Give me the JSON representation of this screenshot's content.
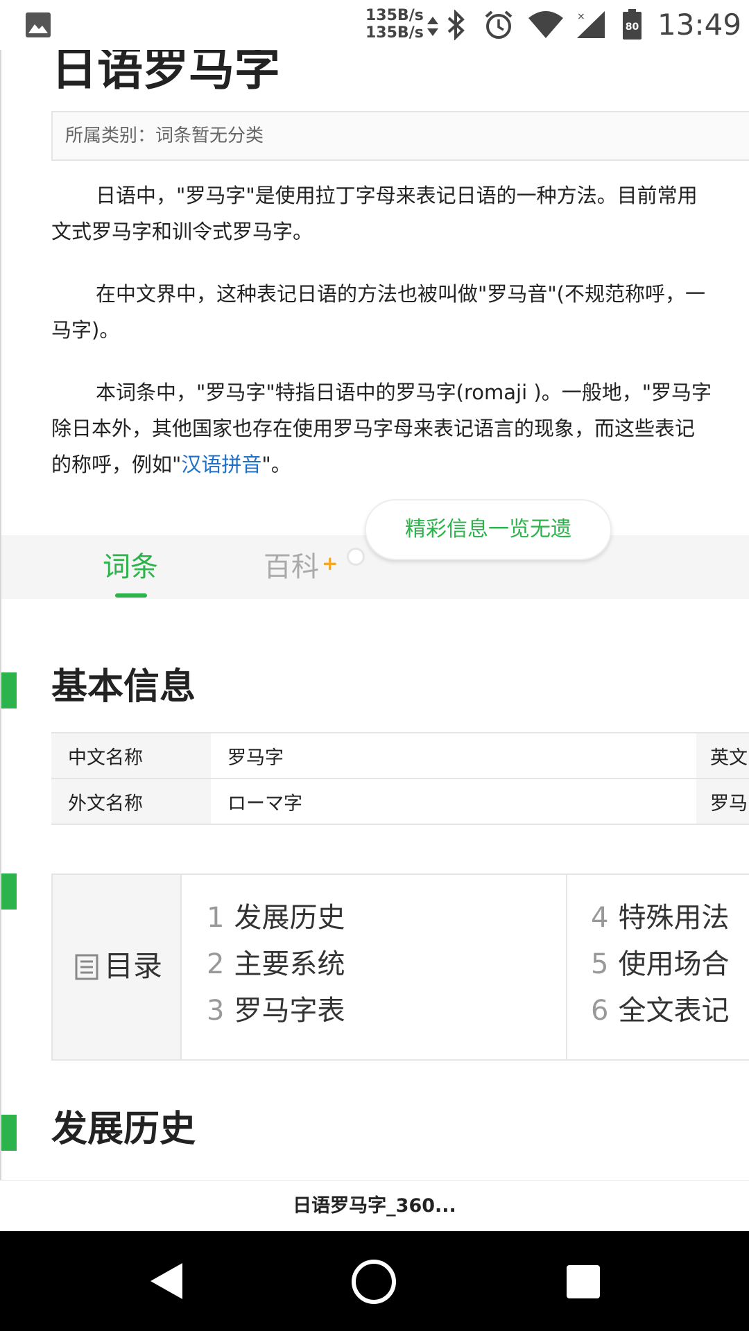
{
  "status_bar": {
    "net_up": "135B/s",
    "net_down": "135B/s",
    "battery": "80",
    "time": "13:49",
    "icons": [
      "photo-icon",
      "data-arrows-icon",
      "bluetooth-icon",
      "alarm-icon",
      "wifi-icon",
      "signal-icon",
      "battery-icon"
    ]
  },
  "page": {
    "title": "日语罗马字",
    "category": "所属类别：词条暂无分类",
    "paragraphs": [
      {
        "line1": "日语中，\"罗马字\"是使用拉丁字母来表记日语的一种方法。目前常用",
        "line2": "文式罗马字和训令式罗马字。"
      },
      {
        "line1": "在中文界中，这种表记日语的方法也被叫做\"罗马音\"(不规范称呼，一",
        "line2": "马字)。"
      },
      {
        "line1": "本词条中，\"罗马字\"特指日语中的罗马字(romaji )。一般地，\"罗马字",
        "line2": "除日本外，其他国家也存在使用罗马字母来表记语言的现象，而这些表记",
        "line3_before": "的称呼，例如\"",
        "line3_link": "汉语拼音",
        "line3_after": "\"。"
      }
    ]
  },
  "tabs": {
    "entry": "词条",
    "baike": "百科",
    "plus": "+",
    "tooltip": "精彩信息一览无遗"
  },
  "basic_info": {
    "heading": "基本信息",
    "rows": [
      {
        "label": "中文名称",
        "value": "罗马字",
        "label2": "英文"
      },
      {
        "label": "外文名称",
        "value": "ローマ字",
        "label2": "罗马"
      }
    ]
  },
  "toc": {
    "title": "目录",
    "items": [
      {
        "num": "1",
        "text": "发展历史"
      },
      {
        "num": "2",
        "text": "主要系统"
      },
      {
        "num": "3",
        "text": "罗马字表"
      },
      {
        "num": "4",
        "text": "特殊用法"
      },
      {
        "num": "5",
        "text": "使用场合"
      },
      {
        "num": "6",
        "text": "全文表记"
      }
    ]
  },
  "section_history": {
    "heading": "发展历史"
  },
  "bottom_bar": {
    "title": "日语罗马字_360..."
  },
  "colors": {
    "accent_green": "#2db34b",
    "link_blue": "#1f6fc5",
    "plus_orange": "#f5a623"
  }
}
